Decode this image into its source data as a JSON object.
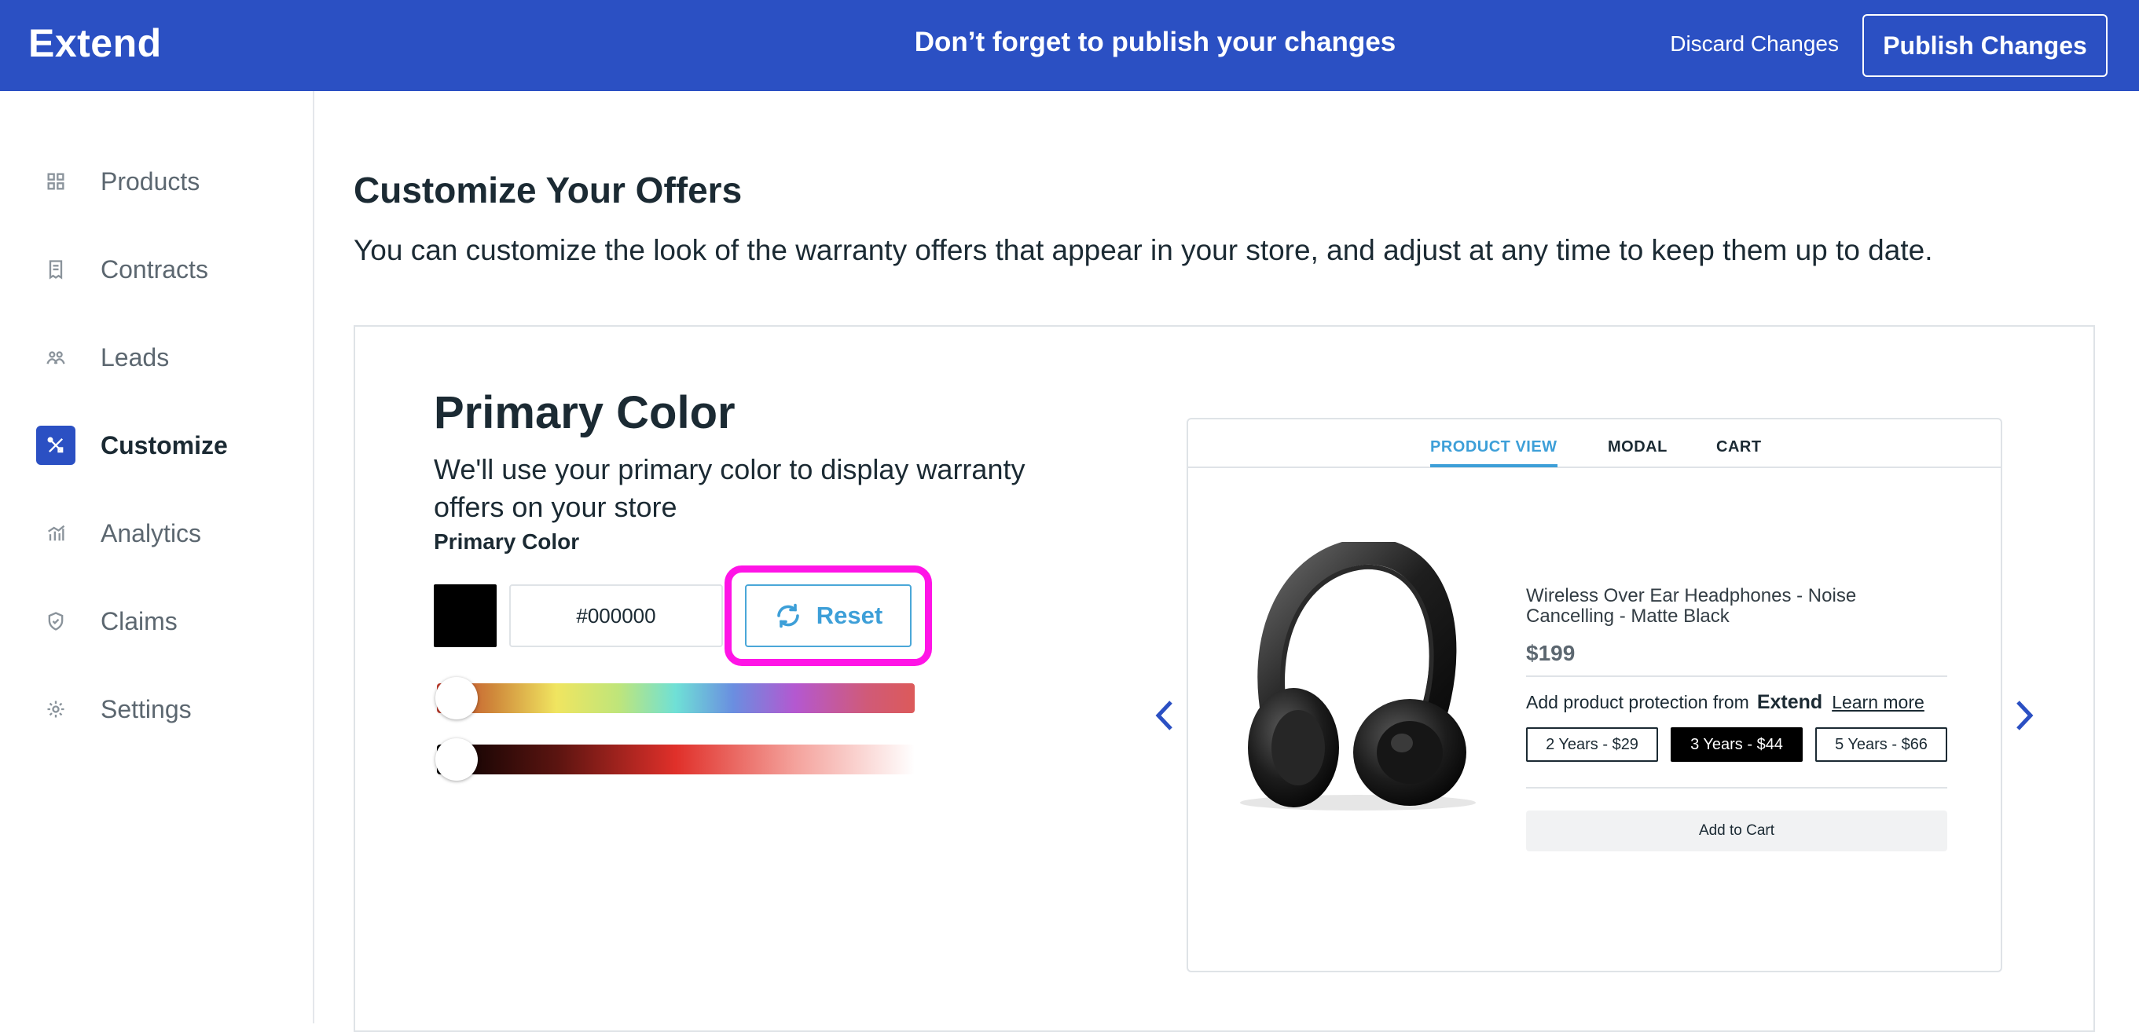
{
  "header": {
    "brand": "Extend",
    "notice": "Don’t forget to publish your changes",
    "discard_label": "Discard Changes",
    "publish_label": "Publish Changes",
    "bar_color": "#2b50c3"
  },
  "sidebar": {
    "items": [
      {
        "label": "Products",
        "icon": "grid-icon",
        "active": false
      },
      {
        "label": "Contracts",
        "icon": "contract-icon",
        "active": false
      },
      {
        "label": "Leads",
        "icon": "people-icon",
        "active": false
      },
      {
        "label": "Customize",
        "icon": "tools-icon",
        "active": true
      },
      {
        "label": "Analytics",
        "icon": "chart-icon",
        "active": false
      },
      {
        "label": "Claims",
        "icon": "shield-icon",
        "active": false
      },
      {
        "label": "Settings",
        "icon": "gear-icon",
        "active": false
      }
    ]
  },
  "main": {
    "title": "Customize Your Offers",
    "description": "You can customize the look of the warranty offers that appear in your store, and adjust at any time to keep them up to date."
  },
  "primary_color": {
    "title": "Primary Color",
    "description": "We'll use your primary color to display warranty offers on your store",
    "field_label": "Primary Color",
    "hex_value": "#000000",
    "reset_label": "Reset",
    "swatch_color": "#000000",
    "hue_slider_value": 0,
    "shade_slider_value": 0
  },
  "preview": {
    "tabs": [
      {
        "label": "PRODUCT VIEW",
        "active": true
      },
      {
        "label": "MODAL",
        "active": false
      },
      {
        "label": "CART",
        "active": false
      }
    ],
    "product_name": "Wireless Over Ear Headphones - Noise Cancelling - Matte Black",
    "price": "$199",
    "protection_text": "Add product protection from",
    "protection_brand": "Extend",
    "learn_more": "Learn more",
    "plans": [
      {
        "label": "2 Years - $29",
        "selected": false
      },
      {
        "label": "3 Years - $44",
        "selected": true
      },
      {
        "label": "5 Years - $66",
        "selected": false
      }
    ],
    "add_to_cart": "Add to Cart"
  }
}
